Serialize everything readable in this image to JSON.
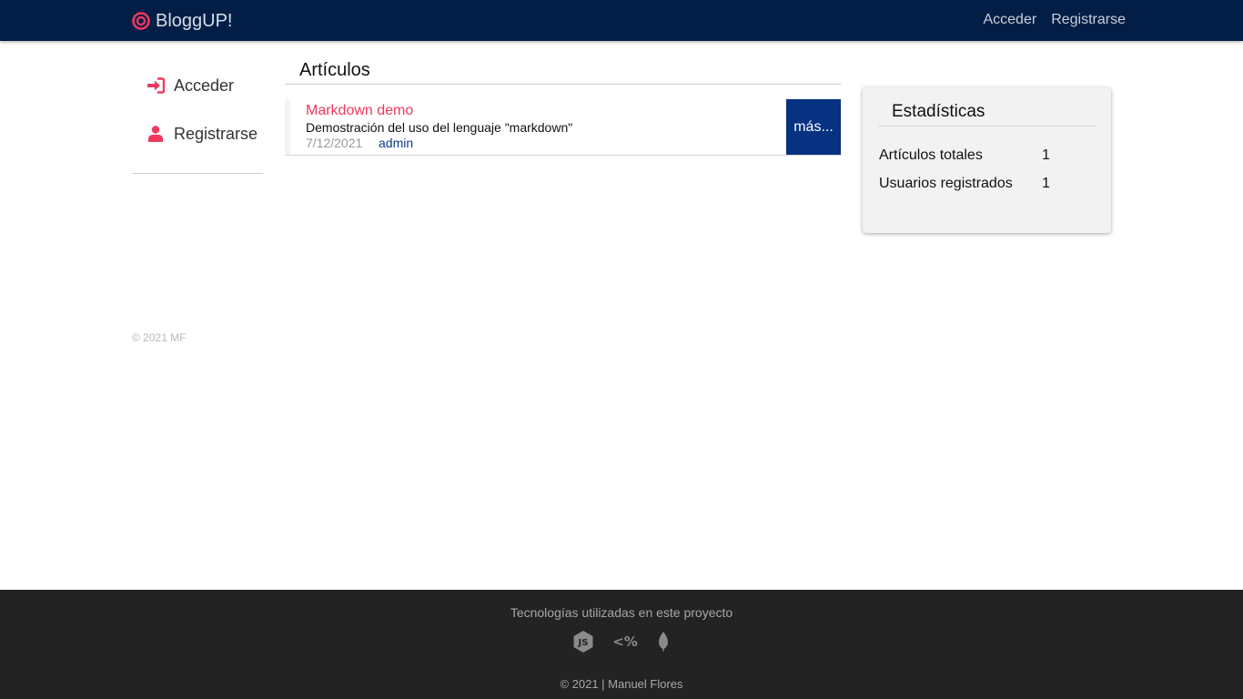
{
  "navbar": {
    "brand": "BloggUP!",
    "links": [
      "Acceder",
      "Registrarse"
    ]
  },
  "sidebar": {
    "items": [
      {
        "label": "Acceder",
        "icon": "sign-in-icon"
      },
      {
        "label": "Registrarse",
        "icon": "user-icon"
      }
    ]
  },
  "articles": {
    "title": "Artículos",
    "list": [
      {
        "title": "Markdown demo",
        "description": "Demostración del uso del lenguaje \"markdown\"",
        "date": "7/12/2021",
        "author": "admin",
        "more_label": "más..."
      }
    ]
  },
  "stats": {
    "title": "Estadísticas",
    "rows": [
      {
        "label": "Artículos totales",
        "value": "1"
      },
      {
        "label": "Usuarios registrados",
        "value": "1"
      }
    ]
  },
  "copyright": "© 2021 MF",
  "footer": {
    "title": "Tecnologías utilizadas en este proyecto",
    "icons": [
      "nodejs-icon",
      "ejs-icon",
      "mongodb-icon"
    ],
    "copy": "© 2021 | Manuel Flores"
  },
  "colors": {
    "navbar": "#031e46",
    "accent": "#f0385f",
    "button": "#063281",
    "footer": "#232323"
  }
}
